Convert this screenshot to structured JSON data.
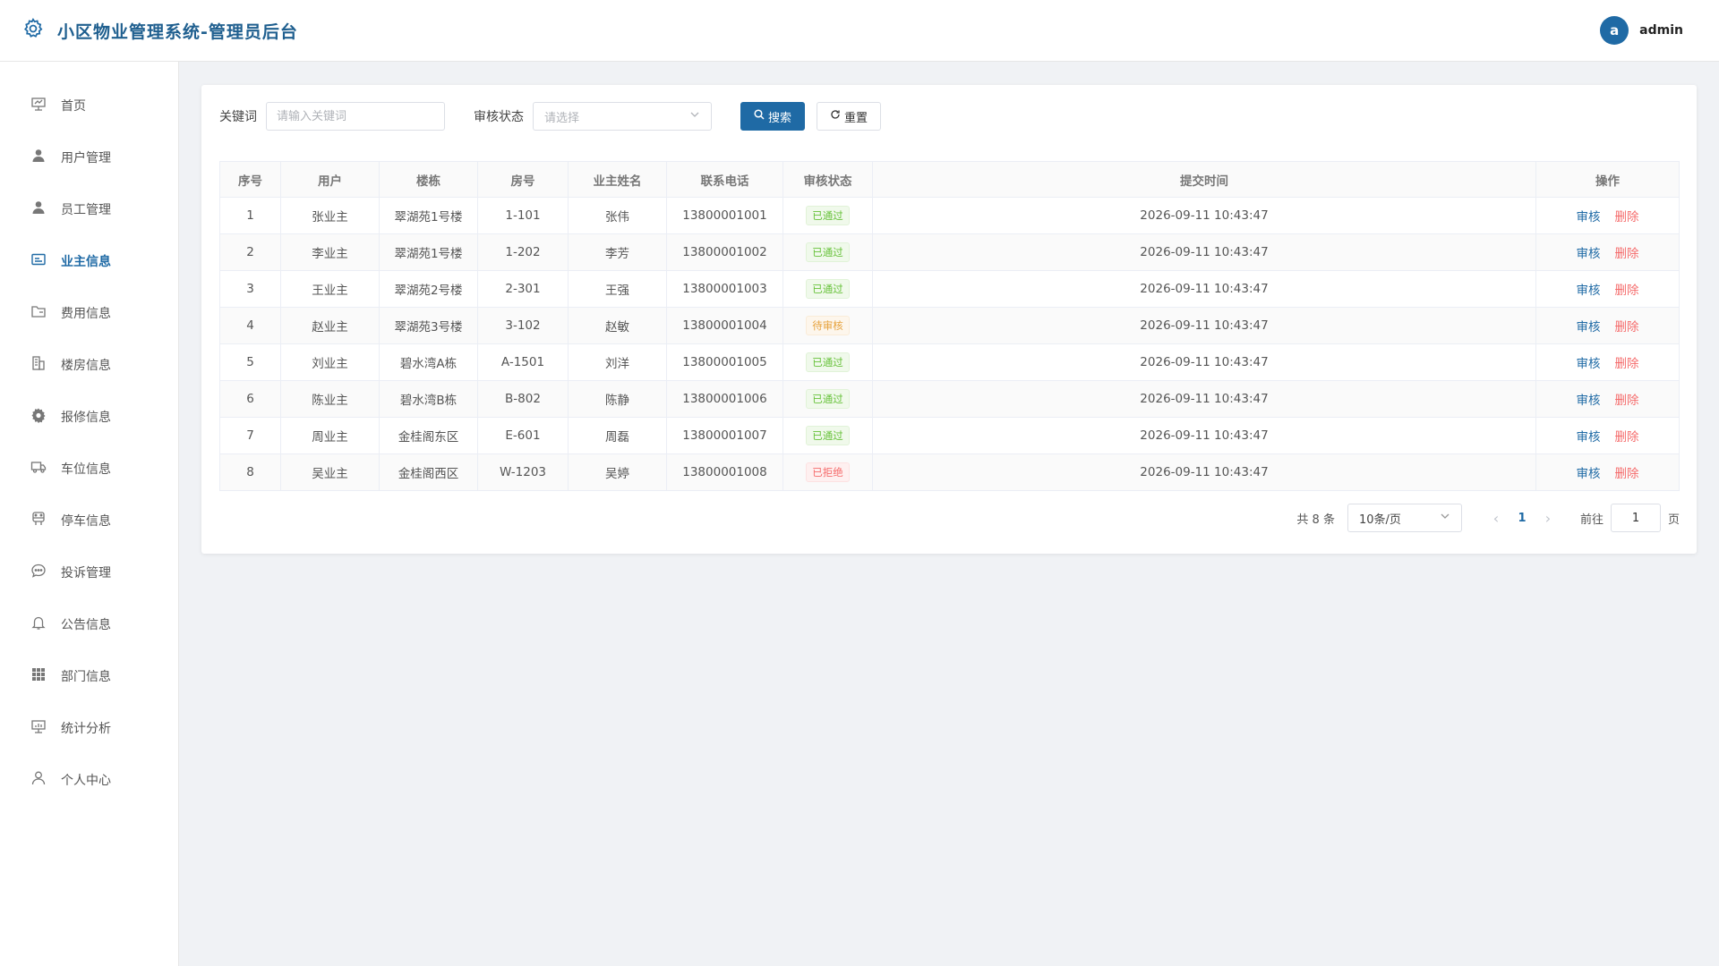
{
  "header": {
    "title": "小区物业管理系统-管理员后台",
    "avatar_letter": "a",
    "username": "admin"
  },
  "sidebar": {
    "items": [
      {
        "label": "首页",
        "icon": "presentation-icon"
      },
      {
        "label": "用户管理",
        "icon": "user-solid-icon"
      },
      {
        "label": "员工管理",
        "icon": "user-solid-icon"
      },
      {
        "label": "业主信息",
        "icon": "id-card-icon",
        "active": true
      },
      {
        "label": "费用信息",
        "icon": "folder-icon"
      },
      {
        "label": "楼房信息",
        "icon": "building-icon"
      },
      {
        "label": "报修信息",
        "icon": "gear-icon"
      },
      {
        "label": "车位信息",
        "icon": "truck-icon"
      },
      {
        "label": "停车信息",
        "icon": "parking-icon"
      },
      {
        "label": "投诉管理",
        "icon": "chat-icon"
      },
      {
        "label": "公告信息",
        "icon": "bell-icon"
      },
      {
        "label": "部门信息",
        "icon": "grid-icon"
      },
      {
        "label": "统计分析",
        "icon": "chart-board-icon"
      },
      {
        "label": "个人中心",
        "icon": "user-outline-icon"
      }
    ]
  },
  "search": {
    "keyword_label": "关键词",
    "keyword_placeholder": "请输入关键词",
    "status_label": "审核状态",
    "status_placeholder": "请选择",
    "search_button": "搜索",
    "reset_button": "重置"
  },
  "table": {
    "columns": [
      "序号",
      "用户",
      "楼栋",
      "房号",
      "业主姓名",
      "联系电话",
      "审核状态",
      "提交时间",
      "操作"
    ],
    "audit_label": "审核",
    "delete_label": "删除",
    "rows": [
      {
        "index": "1",
        "user": "张业主",
        "building": "翠湖苑1号楼",
        "room": "1-101",
        "owner": "张伟",
        "phone": "13800001001",
        "status": "已通过",
        "status_type": "success",
        "time": "2026-09-11 10:43:47"
      },
      {
        "index": "2",
        "user": "李业主",
        "building": "翠湖苑1号楼",
        "room": "1-202",
        "owner": "李芳",
        "phone": "13800001002",
        "status": "已通过",
        "status_type": "success",
        "time": "2026-09-11 10:43:47"
      },
      {
        "index": "3",
        "user": "王业主",
        "building": "翠湖苑2号楼",
        "room": "2-301",
        "owner": "王强",
        "phone": "13800001003",
        "status": "已通过",
        "status_type": "success",
        "time": "2026-09-11 10:43:47"
      },
      {
        "index": "4",
        "user": "赵业主",
        "building": "翠湖苑3号楼",
        "room": "3-102",
        "owner": "赵敏",
        "phone": "13800001004",
        "status": "待审核",
        "status_type": "warning",
        "time": "2026-09-11 10:43:47"
      },
      {
        "index": "5",
        "user": "刘业主",
        "building": "碧水湾A栋",
        "room": "A-1501",
        "owner": "刘洋",
        "phone": "13800001005",
        "status": "已通过",
        "status_type": "success",
        "time": "2026-09-11 10:43:47"
      },
      {
        "index": "6",
        "user": "陈业主",
        "building": "碧水湾B栋",
        "room": "B-802",
        "owner": "陈静",
        "phone": "13800001006",
        "status": "已通过",
        "status_type": "success",
        "time": "2026-09-11 10:43:47"
      },
      {
        "index": "7",
        "user": "周业主",
        "building": "金桂阁东区",
        "room": "E-601",
        "owner": "周磊",
        "phone": "13800001007",
        "status": "已通过",
        "status_type": "success",
        "time": "2026-09-11 10:43:47"
      },
      {
        "index": "8",
        "user": "吴业主",
        "building": "金桂阁西区",
        "room": "W-1203",
        "owner": "吴婷",
        "phone": "13800001008",
        "status": "已拒绝",
        "status_type": "danger",
        "time": "2026-09-11 10:43:47"
      }
    ]
  },
  "pagination": {
    "total_text": "共 8 条",
    "page_size": "10条/页",
    "current_page": "1",
    "goto_label": "前往",
    "goto_value": "1",
    "page_suffix": "页"
  },
  "colors": {
    "primary": "#1f6aa5",
    "success": "#67c23a",
    "warning": "#e6a23c",
    "danger": "#f56c6c"
  }
}
